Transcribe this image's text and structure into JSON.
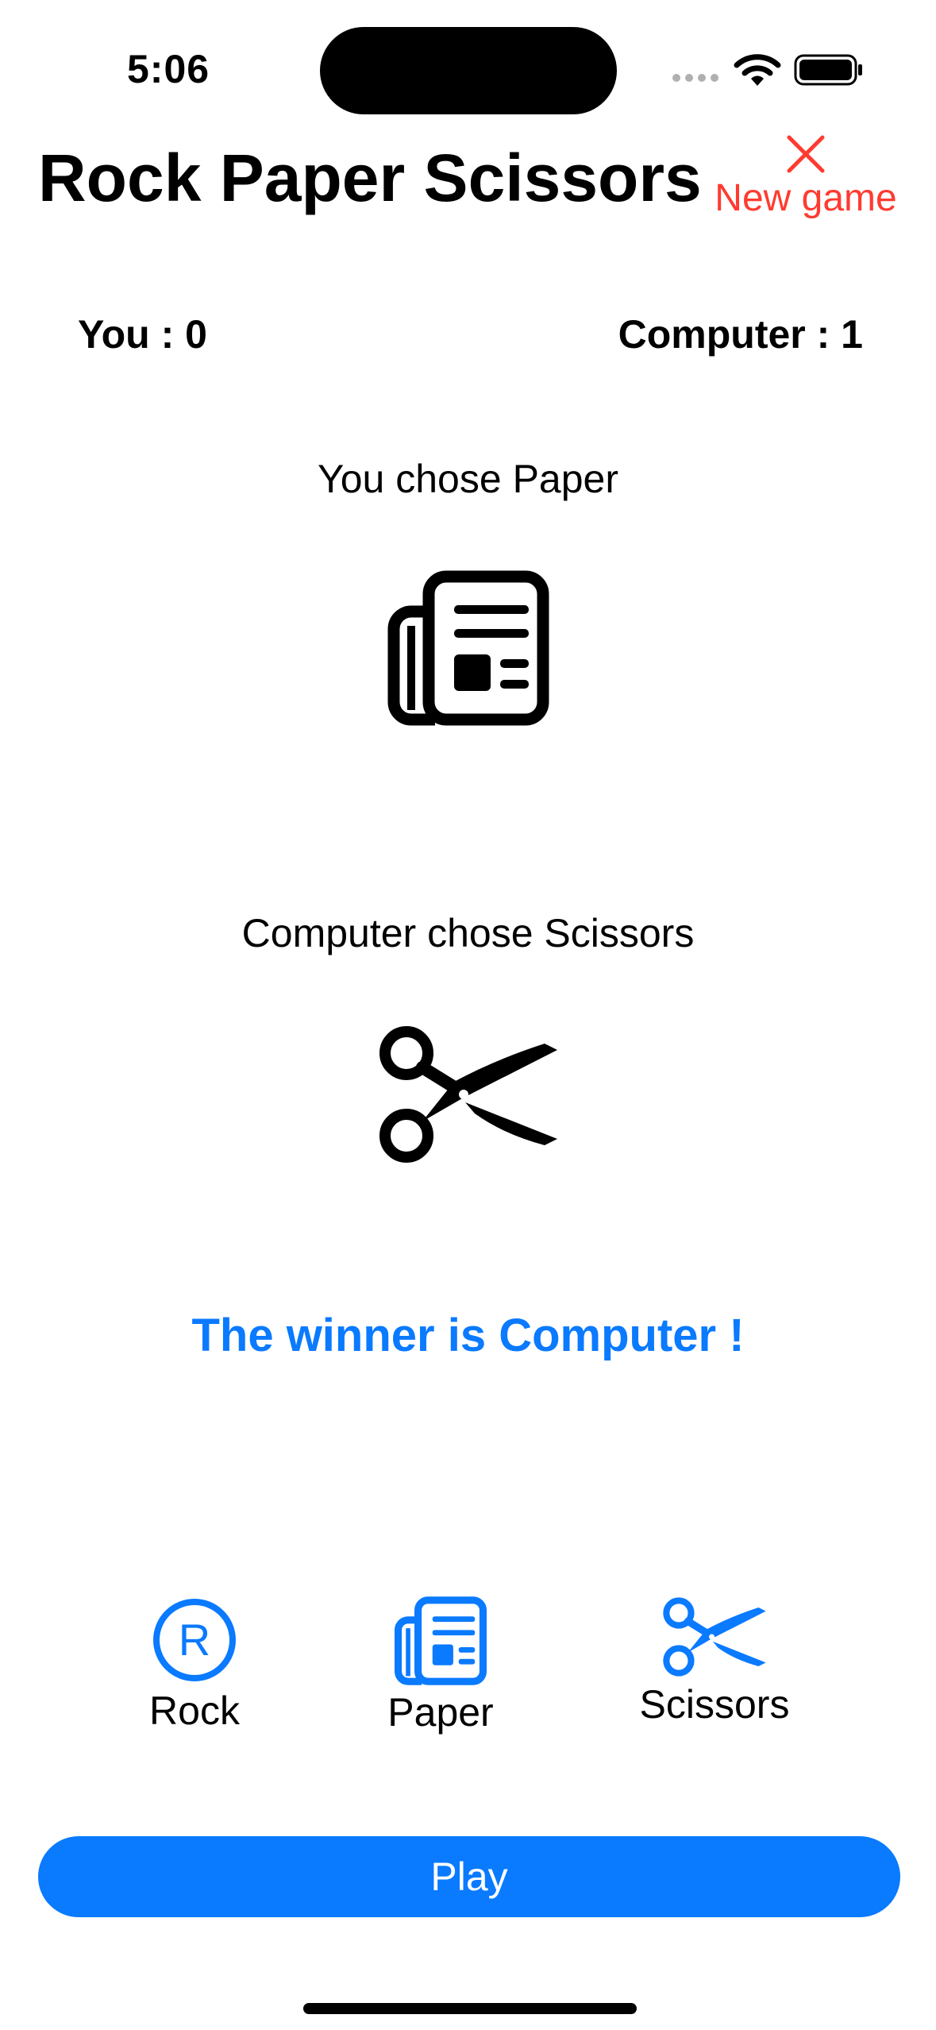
{
  "status_bar": {
    "time": "5:06",
    "icons": [
      "cellular-icon",
      "wifi-icon",
      "battery-icon"
    ]
  },
  "header": {
    "title": "Rock Paper Scissors",
    "new_game_label": "New game",
    "new_game_icon": "close-icon"
  },
  "scores": {
    "you": "You : 0",
    "computer": "Computer : 1"
  },
  "result": {
    "you_chose": "You chose Paper",
    "you_icon": "newspaper-icon",
    "computer_chose": "Computer chose Scissors",
    "computer_icon": "scissors-icon",
    "winner": "The winner is Computer !"
  },
  "picks": [
    {
      "label": "Rock",
      "icon": "registered-circle-icon"
    },
    {
      "label": "Paper",
      "icon": "newspaper-icon"
    },
    {
      "label": "Scissors",
      "icon": "scissors-icon"
    }
  ],
  "play_label": "Play",
  "colors": {
    "accent": "#0a7aff",
    "destructive": "#ff3b30",
    "text": "#000000",
    "background": "#ffffff"
  }
}
